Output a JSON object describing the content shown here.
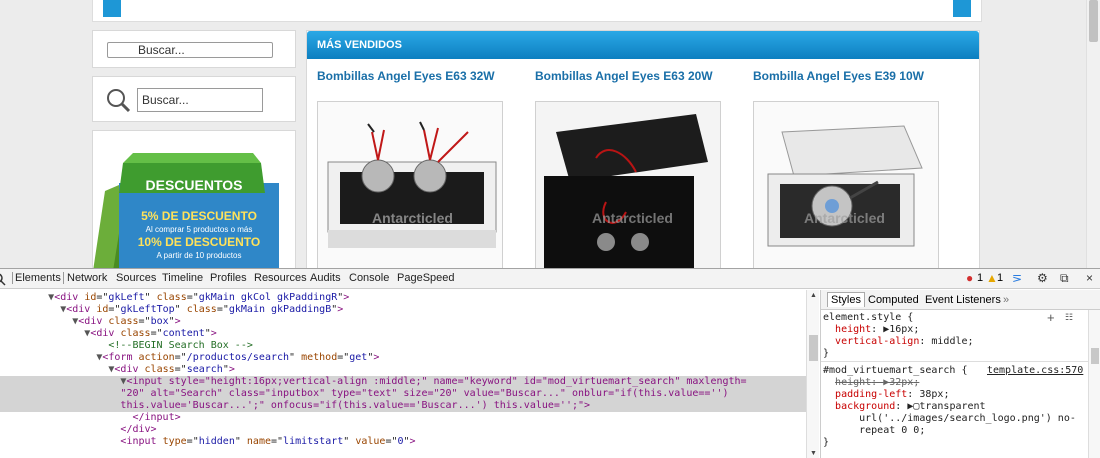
{
  "page": {
    "search_placeholder_1": "Buscar...",
    "search_placeholder_2": "Buscar...",
    "promo": {
      "title": "DESCUENTOS",
      "line1": "5% DE DESCUENTO",
      "line2": "Al comprar 5 productos o más",
      "line3": "10% DE DESCUENTO",
      "line4": "A partir de 10 productos"
    },
    "ventas_title": "MÁS VENDIDOS",
    "products": [
      {
        "name": "Bombillas Angel Eyes E63 32W",
        "watermark": "Antarcticled"
      },
      {
        "name": "Bombillas Angel Eyes E63 20W",
        "watermark": "Antarcticled"
      },
      {
        "name": "Bombilla Angel Eyes E39 10W",
        "watermark": "Antarcticled"
      }
    ]
  },
  "devtools": {
    "tabs": [
      "Elements",
      "Network",
      "Sources",
      "Timeline",
      "Profiles",
      "Resources",
      "Audits",
      "Console",
      "PageSpeed"
    ],
    "error_count": "1",
    "warning_count": "1",
    "elements": [
      {
        "indent": "        ",
        "tri": "▼",
        "tag": "<div",
        "attrs": [
          [
            "id",
            "gkLeft"
          ],
          [
            "class",
            "gkMain gkCol gkPaddingR"
          ]
        ],
        "close": ">"
      },
      {
        "indent": "          ",
        "tri": "▼",
        "tag": "<div",
        "attrs": [
          [
            "id",
            "gkLeftTop"
          ],
          [
            "class",
            "gkMain gkPaddingB"
          ]
        ],
        "close": ">"
      },
      {
        "indent": "            ",
        "tri": "▼",
        "tag": "<div",
        "attrs": [
          [
            "class",
            "box"
          ]
        ],
        "close": ">"
      },
      {
        "indent": "              ",
        "tri": "▼",
        "tag": "<div",
        "attrs": [
          [
            "class",
            "content"
          ]
        ],
        "close": ">"
      },
      {
        "indent": "                  ",
        "tri": "",
        "comment": "<!--BEGIN Search Box -->"
      },
      {
        "indent": "                ",
        "tri": "▼",
        "tag": "<form",
        "attrs": [
          [
            "action",
            "/productos/search"
          ],
          [
            "method",
            "get"
          ]
        ],
        "close": ">"
      },
      {
        "indent": "                  ",
        "tri": "▼",
        "tag": "<div",
        "attrs": [
          [
            "class",
            "search"
          ]
        ],
        "close": ">"
      },
      {
        "indent": "                    ",
        "tri": "▼",
        "selected": true,
        "raw": "<input style=\"height:16px;vertical-align :middle;\" name=\"keyword\" id=\"mod_virtuemart_search\" maxlength="
      },
      {
        "indent": "                    ",
        "tri": "",
        "selected": true,
        "raw": "\"20\" alt=\"Search\" class=\"inputbox\" type=\"text\" size=\"20\" value=\"Buscar...\" onblur=\"if(this.value=='')"
      },
      {
        "indent": "                    ",
        "tri": "",
        "selected": true,
        "raw": "this.value='Buscar...';\" onfocus=\"if(this.value=='Buscar...') this.value='';\">"
      },
      {
        "indent": "                      ",
        "tri": "",
        "tag": "</input>",
        "attrs": [],
        "close": ""
      },
      {
        "indent": "                    ",
        "tri": "",
        "tag": "</div>",
        "attrs": [],
        "close": ""
      },
      {
        "indent": "                    ",
        "tri": "",
        "tag": "<input",
        "attrs": [
          [
            "type",
            "hidden"
          ],
          [
            "name",
            "limitstart"
          ],
          [
            "value",
            "0"
          ]
        ],
        "close": ">"
      }
    ],
    "styles": {
      "tabs": [
        "Styles",
        "Computed",
        "Event Listeners",
        "»"
      ],
      "element_style_selector": "element.style {",
      "element_style_props": [
        [
          "height",
          "▶16px"
        ],
        [
          "vertical-align",
          "middle"
        ]
      ],
      "rule_selector": "#mod_virtuemart_search {",
      "rule_source": "template.css:570",
      "rule_props": [
        {
          "name": "height",
          "value": "▶32px",
          "struck": true
        },
        {
          "name": "padding-left",
          "value": "38px",
          "struck": false
        },
        {
          "name": "background",
          "value": "▶▢transparent",
          "struck": false
        }
      ],
      "bg_cont_1": "url('../images/search_logo.png') no-",
      "bg_cont_2": "repeat 0 0;",
      "close_brace": "}"
    }
  }
}
